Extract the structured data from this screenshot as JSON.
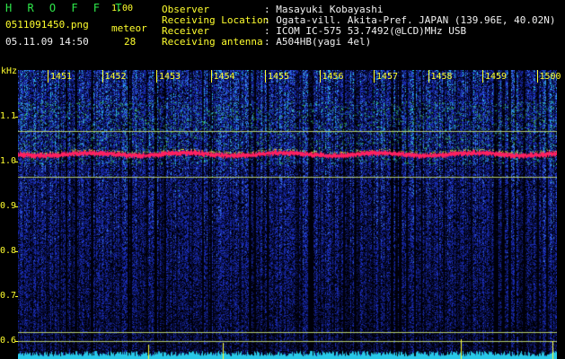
{
  "header": {
    "app_title": "H R O F F T",
    "app_version": "1.00",
    "filename": "0511091450.png",
    "mode_label": "meteor",
    "datetime": "05.11.09 14:50",
    "count": "28",
    "info_labels": [
      "Observer",
      "Receiving Location",
      "Receiver",
      "Receiving antenna"
    ],
    "info_values": [
      ": Masayuki Kobayashi",
      ": Ogata-vill. Akita-Pref. JAPAN (139.96E, 40.02N)",
      ": ICOM IC-575 53.7492(@LCD)MHz USB",
      ": A504HB(yagi 4el)"
    ]
  },
  "axis": {
    "unit": "kHz",
    "y_ticks": [
      "1.1",
      "1.0",
      "0.9",
      "0.8",
      "0.7",
      "0.6"
    ],
    "time_ticks": [
      "1451",
      "1452",
      "1453",
      "1454",
      "1455",
      "1456",
      "1457",
      "1458",
      "1459",
      "1500"
    ]
  },
  "colors": {
    "background": "#000000",
    "label_green": "#2ee84a",
    "label_yellow": "#ffff2e",
    "signal_red": "#ff2060",
    "noise_blue": "#1a2db8",
    "noise_cyan": "#28c8e8",
    "ref_line": "#b8d070"
  }
}
